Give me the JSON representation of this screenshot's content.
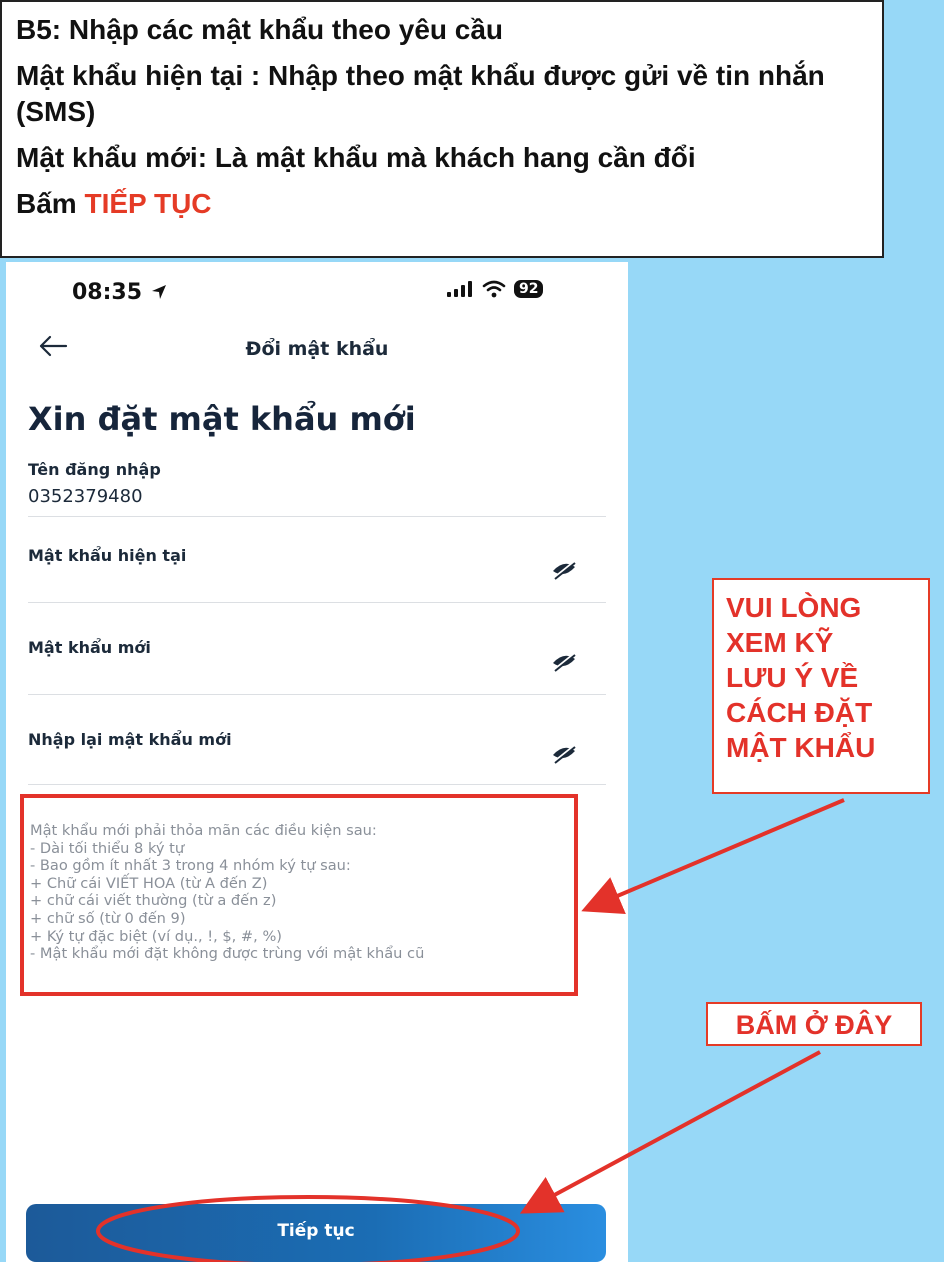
{
  "instructions": {
    "step": "B5:  Nhập các mật khẩu theo yêu cầu",
    "current_pw_note": "Mật khẩu hiện tại : Nhập theo mật khẩu được gửi về tin nhắn (SMS)",
    "new_pw_note": "Mật khẩu mới: Là mật khẩu mà khách hang cần đổi",
    "press_prefix": "Bấm ",
    "press_action": "TIẾP TỤC"
  },
  "status_bar": {
    "time": "08:35",
    "battery": "92"
  },
  "nav": {
    "title": "Đổi mật khẩu"
  },
  "heading": "Xin đặt mật khẩu mới",
  "username": {
    "label": "Tên đăng nhập",
    "value": "0352379480"
  },
  "fields": {
    "current_password": "Mật khẩu hiện tại",
    "new_password": "Mật khẩu mới",
    "confirm_password": "Nhập lại mật khẩu mới"
  },
  "rules": [
    "Mật khẩu mới phải thỏa mãn các điều kiện sau:",
    " - Dài tối thiểu 8 ký tự",
    " - Bao gồm ít nhất 3 trong 4 nhóm ký tự sau:",
    "  + Chữ cái VIẾT HOA (từ A đến Z)",
    "  + chữ cái viết thường (từ a đến z)",
    "  + chữ số (từ 0 đến 9)",
    "  + Ký tự đặc biệt (ví dụ., !, $, #, %)",
    " - Mật khẩu mới đặt không được trùng với mật khẩu cũ"
  ],
  "continue_button": "Tiếp tục",
  "callouts": {
    "review_notes": [
      "VUI LÒNG",
      "XEM KỸ",
      "LƯU Ý VỀ",
      "CÁCH ĐẶT",
      "MẬT KHẨU"
    ],
    "press_here": "BẤM Ở ĐÂY"
  },
  "colors": {
    "background": "#97d8f7",
    "annotation_red": "#e3322a",
    "button_blue": "#1b6db4",
    "heading_navy": "#16253b"
  },
  "icons": [
    "location-arrow-icon",
    "signal-icon",
    "wifi-icon",
    "battery-icon",
    "back-arrow-icon",
    "eye-slash-icon"
  ]
}
